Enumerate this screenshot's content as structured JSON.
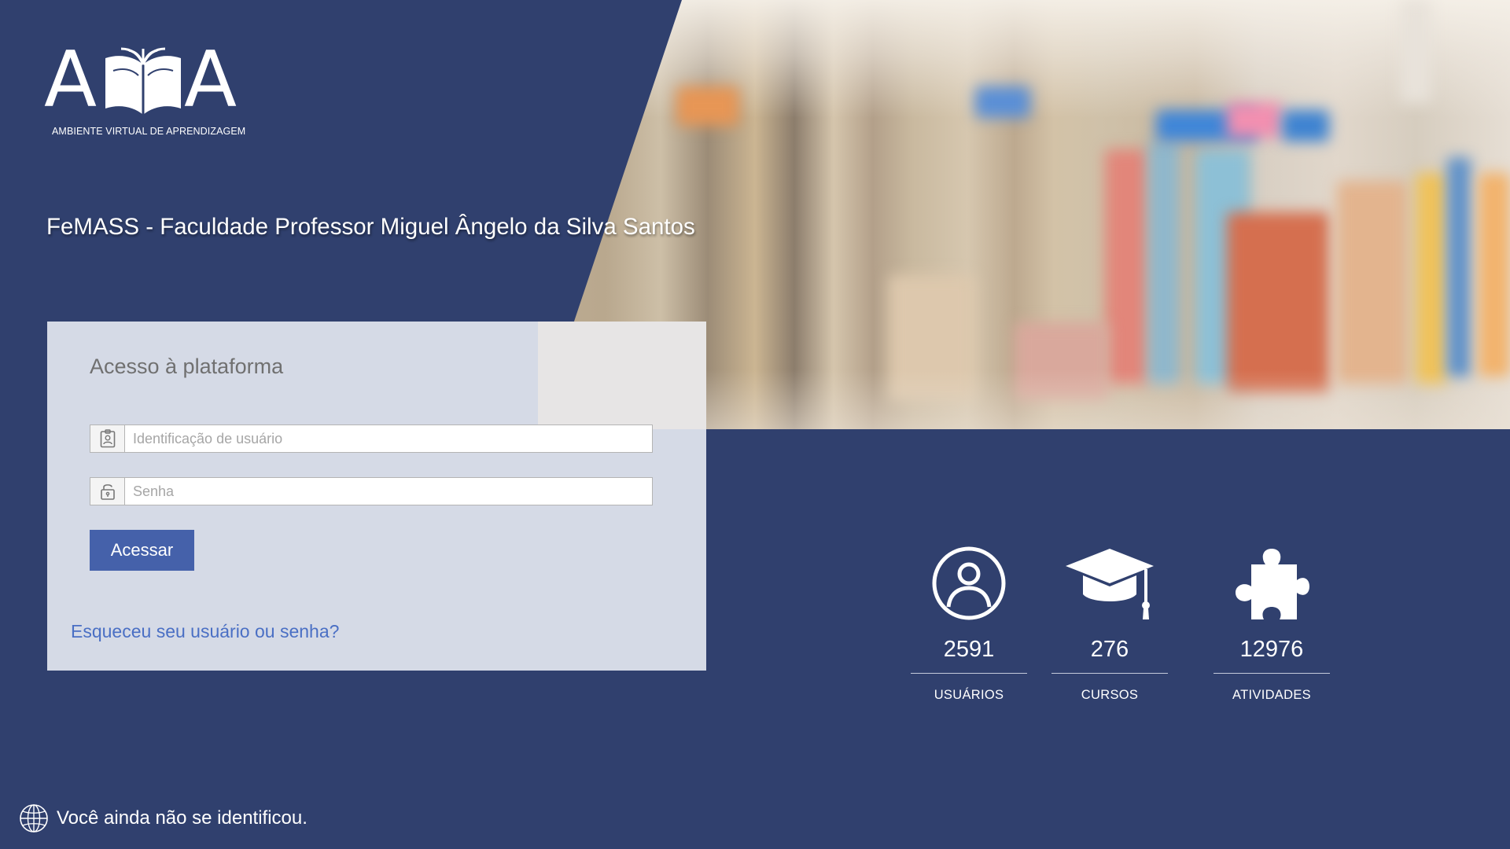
{
  "branding": {
    "logo_text": "AVA",
    "logo_letter_left": "A",
    "logo_letter_right": "A",
    "logo_caption": "AMBIENTE VIRTUAL DE APRENDIZAGEM",
    "institution_title": "FeMASS - Faculdade Professor Miguel Ângelo da Silva Santos"
  },
  "login": {
    "title": "Acesso à plataforma",
    "username_placeholder": "Identificação de usuário",
    "password_placeholder": "Senha",
    "submit_label": "Acessar",
    "forgot_link": "Esqueceu seu usuário ou senha?"
  },
  "stats": [
    {
      "icon": "user-circle-icon",
      "value": "2591",
      "label": "USUÁRIOS"
    },
    {
      "icon": "graduation-cap-icon",
      "value": "276",
      "label": "CURSOS"
    },
    {
      "icon": "puzzle-piece-icon",
      "value": "12976",
      "label": "ATIVIDADES"
    }
  ],
  "footer": {
    "icon": "globe-icon",
    "status_text": "Você ainda não se identificou."
  },
  "colors": {
    "primary_navy": "#30406e",
    "button_blue": "#4561aa",
    "link_blue": "#4a6fc4",
    "card_bg": "#d5dae6"
  }
}
